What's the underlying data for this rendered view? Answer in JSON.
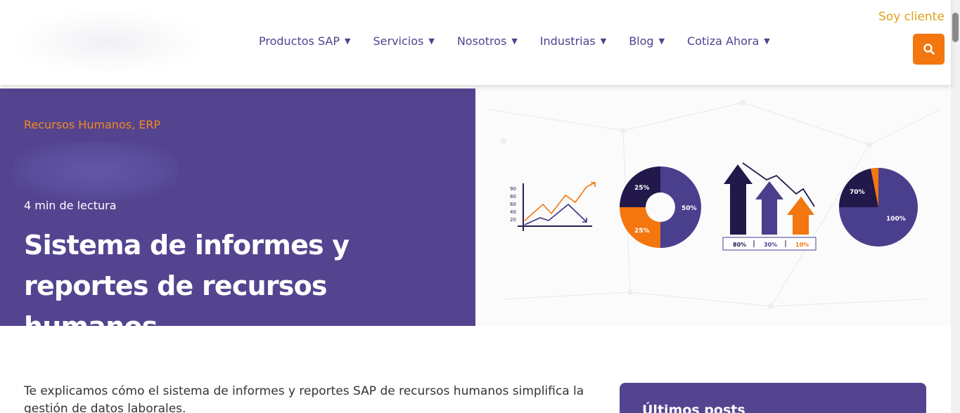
{
  "header": {
    "nav": [
      {
        "label": "Productos SAP"
      },
      {
        "label": "Servicios"
      },
      {
        "label": "Nosotros"
      },
      {
        "label": "Industrias"
      },
      {
        "label": "Blog"
      },
      {
        "label": "Cotiza Ahora"
      }
    ],
    "soy_cliente": "Soy cliente",
    "search_icon": "search-icon"
  },
  "hero": {
    "categories": "Recursos Humanos, ERP",
    "read_time": "4 min de lectura",
    "title": "Sistema de informes y reportes de recursos humanos",
    "illustration": {
      "line_chart_ticks": [
        "90",
        "80",
        "60",
        "40",
        "20"
      ],
      "donut_labels": [
        "25%",
        "50%",
        "25%"
      ],
      "arrow_labels": [
        "80%",
        "30%",
        "10%"
      ],
      "pie_labels": [
        "70%",
        "100%"
      ]
    }
  },
  "content": {
    "intro": "Te explicamos cómo el sistema de informes y reportes SAP de recursos humanos simplifica la gestión de datos laborales.",
    "sidebar_title": "Últimos posts"
  },
  "colors": {
    "brand_purple": "#544490",
    "accent_orange": "#f3760f",
    "gold": "#e0a11a",
    "nav_text": "#4a4590"
  }
}
